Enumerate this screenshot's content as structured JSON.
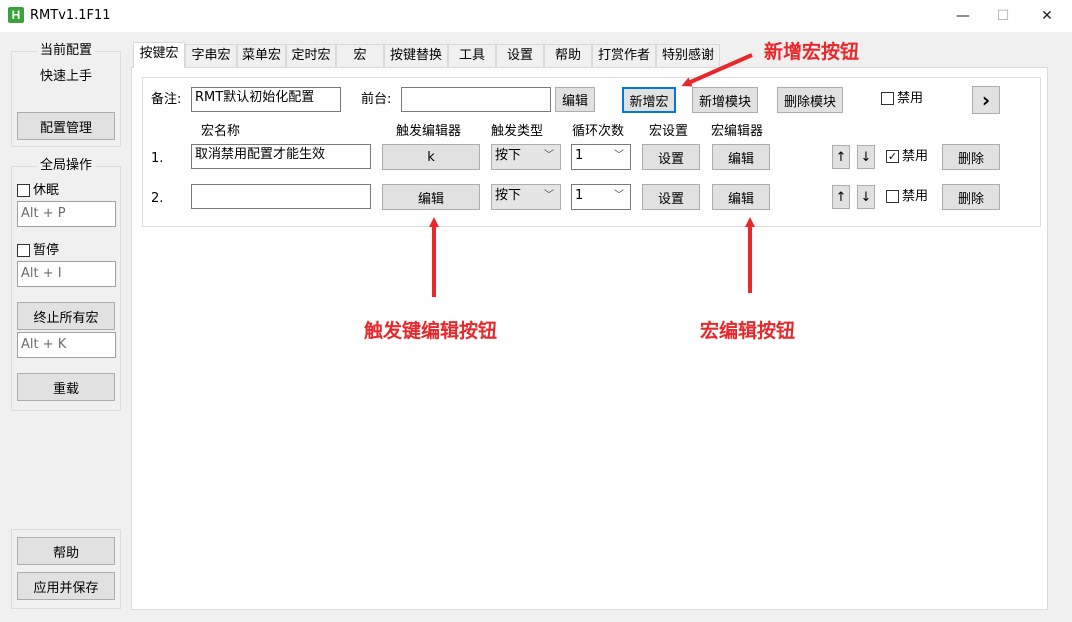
{
  "window": {
    "icon_letter": "H",
    "title": "RMTv1.1F11",
    "minimize": "—",
    "maximize": "☐",
    "close": "✕"
  },
  "sidebar": {
    "current_config_title": "当前配置",
    "current_config_value": "快速上手",
    "config_manage_button": "配置管理",
    "global_ops_title": "全局操作",
    "sleep_label": "休眠",
    "sleep_hotkey": "Alt + P",
    "pause_label": "暂停",
    "pause_hotkey": "Alt + I",
    "stop_all_button": "终止所有宏",
    "stop_all_hotkey": "Alt + K",
    "reload_button": "重载",
    "help_button": "帮助",
    "apply_save_button": "应用并保存"
  },
  "tabs": [
    "按键宏",
    "字串宏",
    "菜单宏",
    "定时宏",
    "宏",
    "按键替换",
    "工具",
    "设置",
    "帮助",
    "打赏作者",
    "特别感谢"
  ],
  "main": {
    "note_label": "备注:",
    "note_value": "RMT默认初始化配置",
    "foreground_label": "前台:",
    "foreground_value": "",
    "edit_label": "编辑",
    "add_macro_button": "新增宏",
    "add_module_button": "新增模块",
    "delete_module_button": "删除模块",
    "disable_label": "禁用",
    "next_button": "›",
    "headers": {
      "name": "宏名称",
      "trigger_editor": "触发编辑器",
      "trigger_type": "触发类型",
      "loop_count": "循环次数",
      "macro_settings": "宏设置",
      "macro_editor": "宏编辑器"
    },
    "rows": [
      {
        "index": "1.",
        "name": "取消禁用配置才能生效",
        "trigger": "k",
        "trigger_type": "按下",
        "loop": "1",
        "settings": "设置",
        "editor": "编辑",
        "up": "↑",
        "down": "↓",
        "disabled_checked": "✓",
        "disable_label": "禁用",
        "delete": "删除"
      },
      {
        "index": "2.",
        "name": "",
        "trigger": "编辑",
        "trigger_type": "按下",
        "loop": "1",
        "settings": "设置",
        "editor": "编辑",
        "up": "↑",
        "down": "↓",
        "disabled_checked": "",
        "disable_label": "禁用",
        "delete": "删除"
      }
    ]
  },
  "annotations": {
    "add_macro": "新增宏按钮",
    "trigger_edit": "触发键编辑按钮",
    "macro_edit": "宏编辑按钮",
    "color": "#e8282b"
  }
}
